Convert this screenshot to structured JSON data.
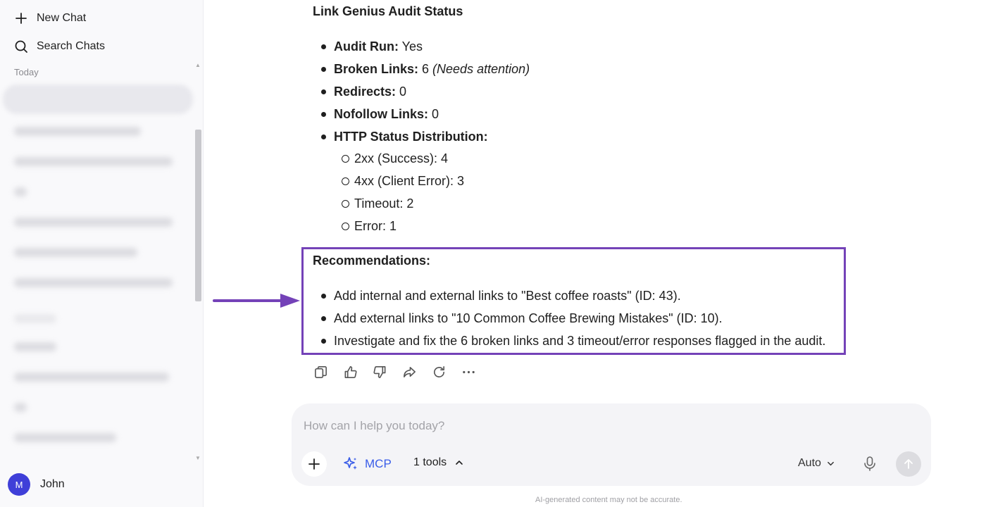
{
  "sidebar": {
    "new_chat_label": "New Chat",
    "search_label": "Search Chats",
    "section_today": "Today",
    "user": {
      "avatar_initial": "M",
      "name": "John"
    }
  },
  "response": {
    "heading": "Link Genius Audit Status",
    "items": [
      {
        "label": "Audit Run:",
        "value": " Yes",
        "note": ""
      },
      {
        "label": "Broken Links:",
        "value": " 6 ",
        "note": "(Needs attention)"
      },
      {
        "label": "Redirects:",
        "value": " 0",
        "note": ""
      },
      {
        "label": "Nofollow Links:",
        "value": " 0",
        "note": ""
      },
      {
        "label": "HTTP Status Distribution:",
        "value": "",
        "note": ""
      }
    ],
    "status_distribution": [
      "2xx (Success): 4",
      "4xx (Client Error): 3",
      "Timeout: 2",
      "Error: 1"
    ],
    "recommendations_heading": "Recommendations:",
    "recommendations": [
      "Add internal and external links to \"Best coffee roasts\" (ID: 43).",
      "Add external links to \"10 Common Coffee Brewing Mistakes\" (ID: 10).",
      "Investigate and fix the 6 broken links and 3 timeout/error responses flagged in the audit."
    ]
  },
  "composer": {
    "placeholder": "How can I help you today?",
    "mcp_label": "MCP",
    "tools_label": "1 tools",
    "model_label": "Auto"
  },
  "disclaimer": "AI-generated content may not be accurate.",
  "colors": {
    "highlight": "#7442b8",
    "accent": "#3a5de8",
    "avatar": "#3f3fd8"
  },
  "icons": [
    "plus-icon",
    "search-icon",
    "copy-icon",
    "thumbs-up-icon",
    "thumbs-down-icon",
    "share-icon",
    "regenerate-icon",
    "more-icon",
    "sparkle-icon",
    "chevron-up-icon",
    "chevron-down-icon",
    "microphone-icon",
    "send-icon",
    "arrow-icon"
  ]
}
